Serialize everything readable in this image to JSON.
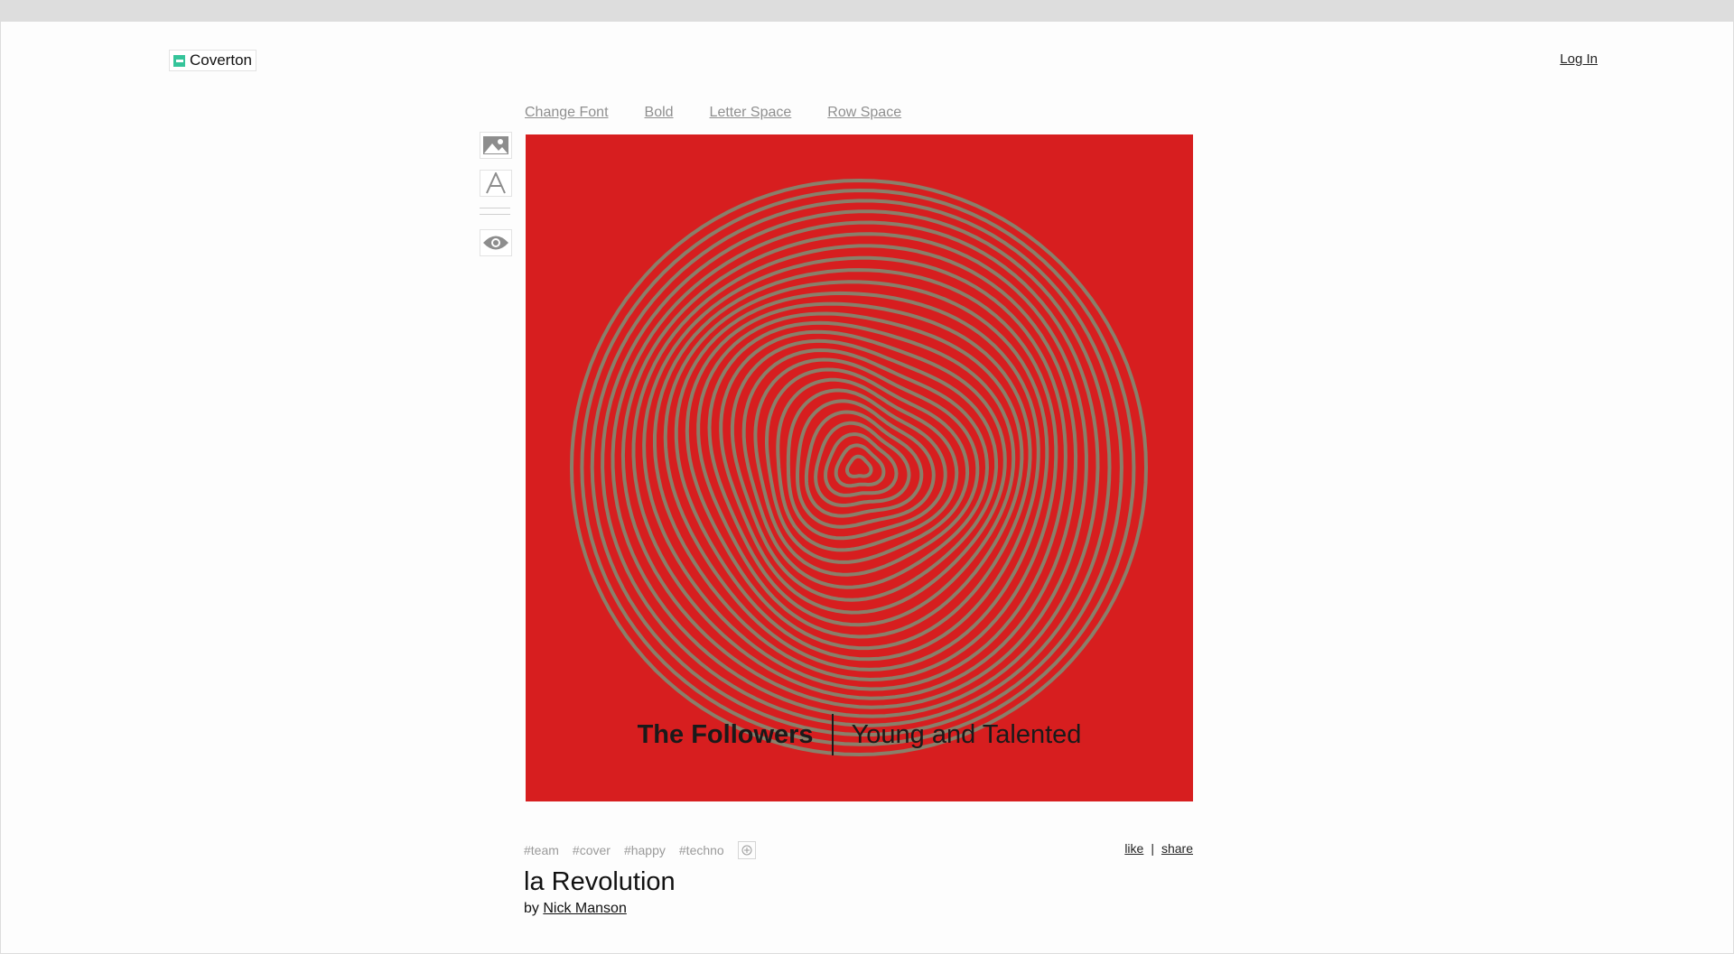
{
  "brand": {
    "name": "Coverton",
    "accent": "#35c49a"
  },
  "header": {
    "login_label": "Log In"
  },
  "toolbar": {
    "change_font": "Change Font",
    "bold": "Bold",
    "letter_space": "Letter Space",
    "row_space": "Row Space"
  },
  "side_tools": [
    "image-icon",
    "text-icon",
    "divider",
    "eye-icon"
  ],
  "cover": {
    "background": "#d71e1f",
    "line_color": "#8a7f6a",
    "text_left": "The Followers",
    "text_right": "Young and Talented"
  },
  "tags": [
    "#team",
    "#cover",
    "#happy",
    "#techno"
  ],
  "actions": {
    "like": "like",
    "separator": "|",
    "share": "share"
  },
  "post": {
    "title": "la Revolution",
    "by": "by",
    "author": "Nick Manson"
  }
}
